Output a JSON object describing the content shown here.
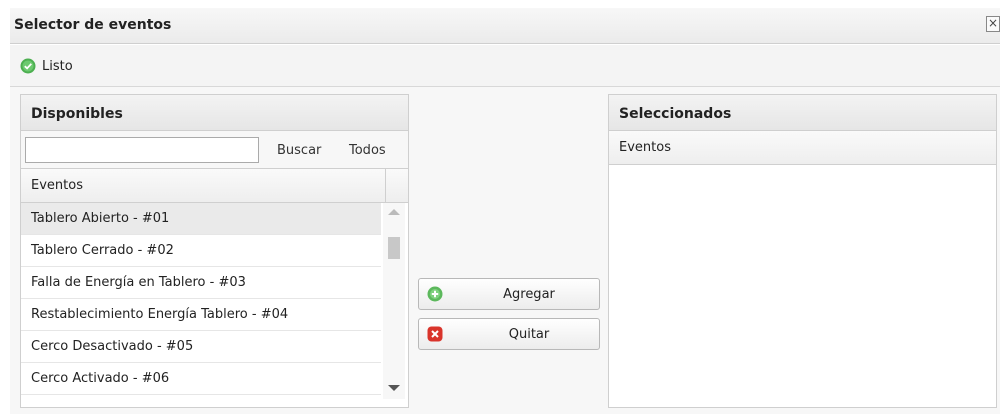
{
  "window": {
    "title": "Selector de eventos",
    "close_label": "×"
  },
  "toolbar": {
    "done_label": "Listo"
  },
  "available": {
    "title": "Disponibles",
    "search": {
      "value": "",
      "placeholder": ""
    },
    "search_button": "Buscar",
    "all_button": "Todos",
    "column_header": "Eventos",
    "items": [
      "Tablero Abierto - #01",
      "Tablero Cerrado - #02",
      "Falla de Energía en Tablero - #03",
      "Restablecimiento Energía Tablero - #04",
      "Cerco Desactivado - #05",
      "Cerco Activado - #06"
    ]
  },
  "actions": {
    "add_label": "Agregar",
    "remove_label": "Quitar"
  },
  "selected": {
    "title": "Seleccionados",
    "column_header": "Eventos",
    "items": []
  },
  "colors": {
    "add_icon": "#5cb85c",
    "remove_icon": "#d9342b",
    "done_icon": "#4caf50"
  }
}
